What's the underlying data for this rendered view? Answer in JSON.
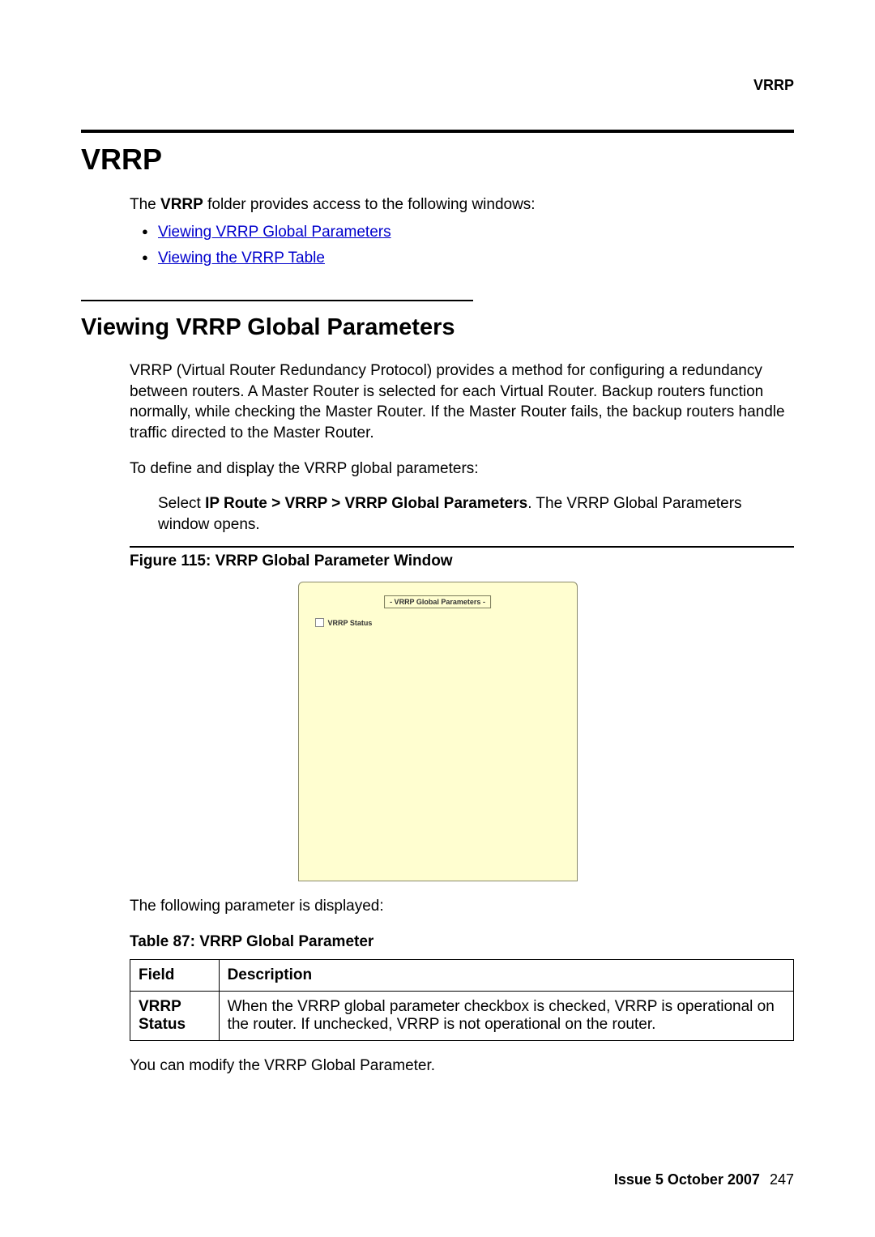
{
  "header": {
    "section": "VRRP"
  },
  "title": "VRRP",
  "intro_prefix": "The ",
  "intro_bold": "VRRP",
  "intro_suffix": " folder provides access to the following windows:",
  "links": {
    "0": "Viewing VRRP Global Parameters",
    "1": "Viewing the VRRP Table"
  },
  "section_heading": "Viewing VRRP Global Parameters",
  "para1": "VRRP (Virtual Router Redundancy Protocol) provides a method for configuring a redundancy between routers. A Master Router is selected for each Virtual Router. Backup routers function normally, while checking the Master Router. If the Master Router fails, the backup routers handle traffic directed to the Master Router.",
  "para2": "To define and display the VRRP global parameters:",
  "step_prefix": "Select ",
  "step_bold": "IP Route > VRRP > VRRP Global Parameters",
  "step_suffix": ". The VRRP Global Parameters window opens.",
  "figure_caption": "Figure 115: VRRP Global Parameter Window",
  "figure": {
    "panel_title": "- VRRP Global Parameters -",
    "checkbox_label": "VRRP Status"
  },
  "para3": "The following parameter is displayed:",
  "table_caption": "Table 87: VRRP Global Parameter",
  "table": {
    "head_field": "Field",
    "head_desc": "Description",
    "row_field": "VRRP Status",
    "row_desc": "When the VRRP global parameter checkbox is checked, VRRP is operational on the router. If unchecked, VRRP is not operational on the router."
  },
  "para4": "You can modify the VRRP Global Parameter.",
  "footer": {
    "issue": "Issue 5   October 2007",
    "page": "247"
  }
}
